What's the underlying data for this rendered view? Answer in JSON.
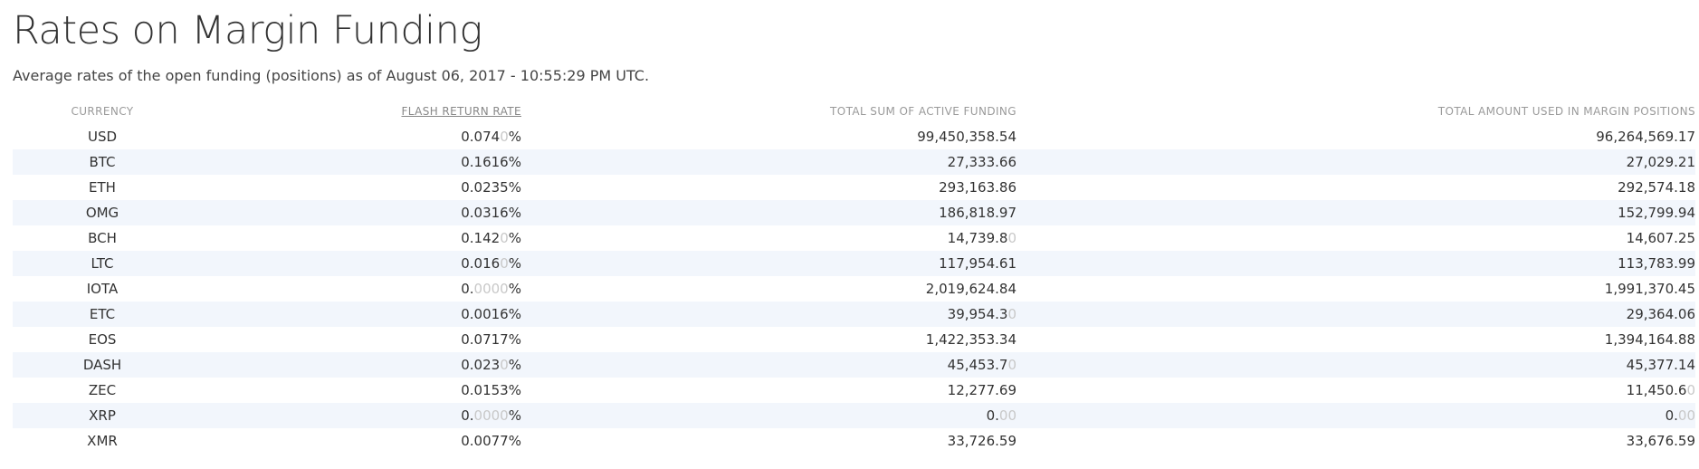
{
  "header": {
    "title": "Rates on Margin Funding",
    "subtitle": "Average rates of the open funding (positions) as of August 06, 2017 - 10:55:29 PM UTC."
  },
  "table": {
    "columns": {
      "currency": "CURRENCY",
      "frr": "FLASH RETURN RATE",
      "total_active": "TOTAL SUM OF ACTIVE FUNDING",
      "total_margin": "TOTAL AMOUNT USED IN MARGIN POSITIONS"
    },
    "rows": [
      {
        "currency": "USD",
        "frr": [
          "0.074",
          "0",
          "%"
        ],
        "total_active": [
          "99,450,358.54",
          "",
          ""
        ],
        "total_margin": [
          "96,264,569.17",
          ""
        ]
      },
      {
        "currency": "BTC",
        "frr": [
          "0.1616",
          "",
          "%"
        ],
        "total_active": [
          "27,333.66",
          "",
          ""
        ],
        "total_margin": [
          "27,029.21",
          ""
        ]
      },
      {
        "currency": "ETH",
        "frr": [
          "0.0235",
          "",
          "%"
        ],
        "total_active": [
          "293,163.86",
          "",
          ""
        ],
        "total_margin": [
          "292,574.18",
          ""
        ]
      },
      {
        "currency": "OMG",
        "frr": [
          "0.0316",
          "",
          "%"
        ],
        "total_active": [
          "186,818.97",
          "",
          ""
        ],
        "total_margin": [
          "152,799.94",
          ""
        ]
      },
      {
        "currency": "BCH",
        "frr": [
          "0.142",
          "0",
          "%"
        ],
        "total_active": [
          "14,739.8",
          "0",
          ""
        ],
        "total_margin": [
          "14,607.25",
          ""
        ]
      },
      {
        "currency": "LTC",
        "frr": [
          "0.016",
          "0",
          "%"
        ],
        "total_active": [
          "117,954.61",
          "",
          ""
        ],
        "total_margin": [
          "113,783.99",
          ""
        ]
      },
      {
        "currency": "IOTA",
        "frr": [
          "0.",
          "0000",
          "%"
        ],
        "total_active": [
          "2,019,624.84",
          "",
          ""
        ],
        "total_margin": [
          "1,991,370.45",
          ""
        ]
      },
      {
        "currency": "ETC",
        "frr": [
          "0.0016",
          "",
          "%"
        ],
        "total_active": [
          "39,954.3",
          "0",
          ""
        ],
        "total_margin": [
          "29,364.06",
          ""
        ]
      },
      {
        "currency": "EOS",
        "frr": [
          "0.0717",
          "",
          "%"
        ],
        "total_active": [
          "1,422,353.34",
          "",
          ""
        ],
        "total_margin": [
          "1,394,164.88",
          ""
        ]
      },
      {
        "currency": "DASH",
        "frr": [
          "0.023",
          "0",
          "%"
        ],
        "total_active": [
          "45,453.7",
          "0",
          ""
        ],
        "total_margin": [
          "45,377.14",
          ""
        ]
      },
      {
        "currency": "ZEC",
        "frr": [
          "0.0153",
          "",
          "%"
        ],
        "total_active": [
          "12,277.69",
          "",
          ""
        ],
        "total_margin": [
          "11,450.6",
          "0"
        ]
      },
      {
        "currency": "XRP",
        "frr": [
          "0.",
          "0000",
          "%"
        ],
        "total_active": [
          "0.",
          "00",
          ""
        ],
        "total_margin": [
          "0.",
          "00"
        ]
      },
      {
        "currency": "XMR",
        "frr": [
          "0.0077",
          "",
          "%"
        ],
        "total_active": [
          "33,726.59",
          "",
          ""
        ],
        "total_margin": [
          "33,676.59",
          ""
        ]
      }
    ]
  }
}
